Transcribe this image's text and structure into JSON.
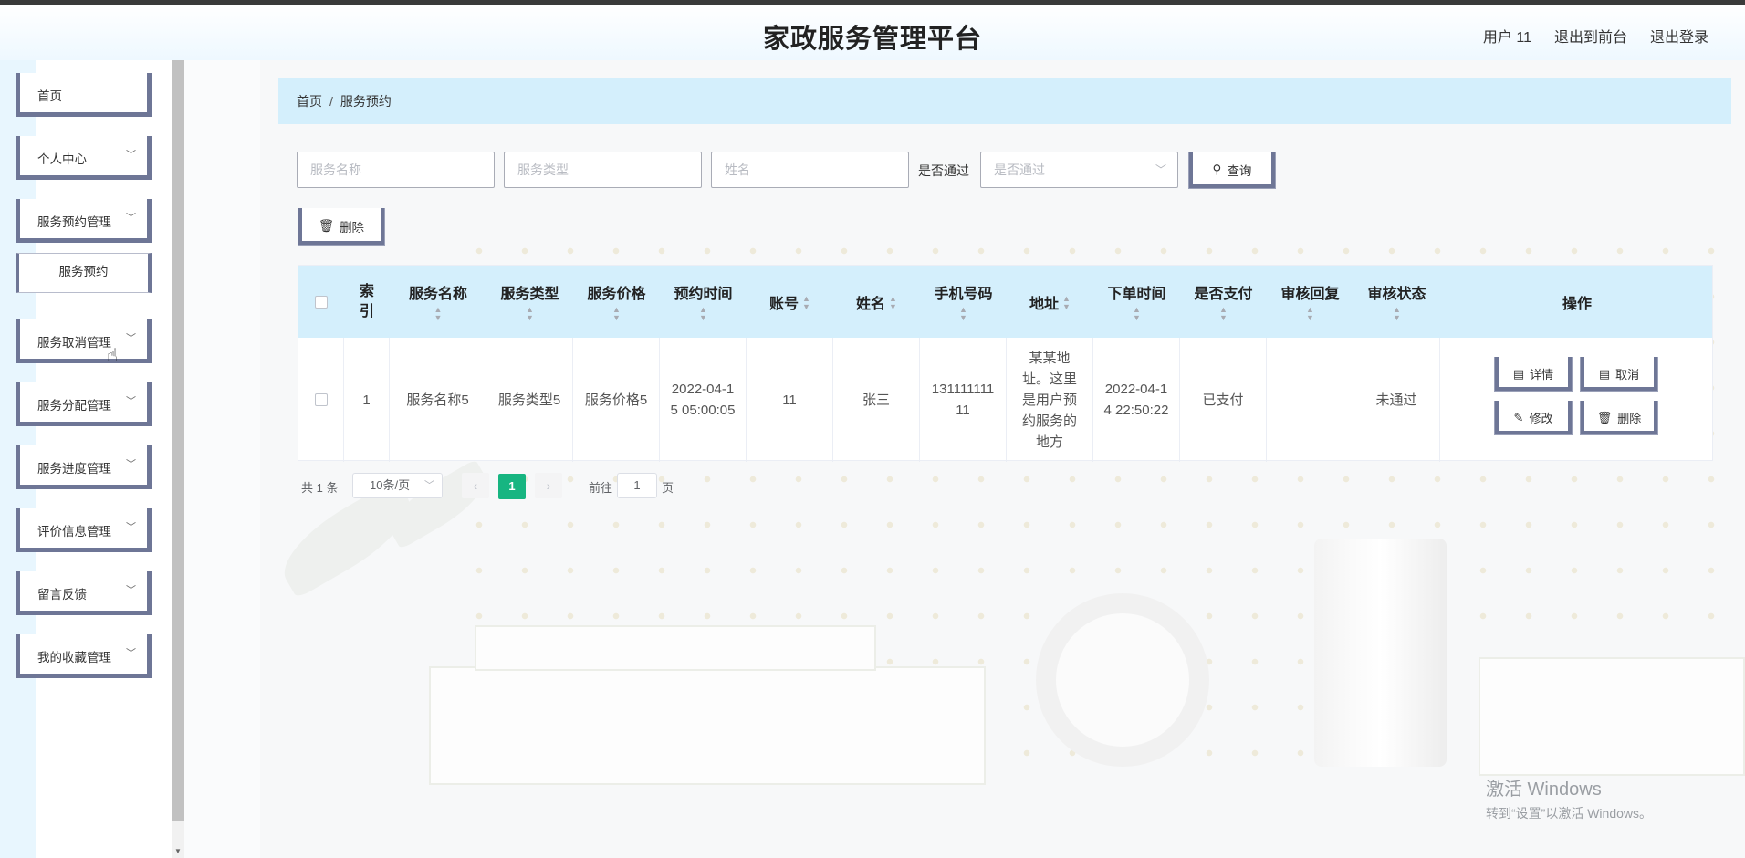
{
  "header": {
    "title": "家政服务管理平台",
    "user": "用户 11",
    "to_front": "退出到前台",
    "logout": "退出登录"
  },
  "sidebar": {
    "items": [
      {
        "label": "首页"
      },
      {
        "label": "个人中心"
      },
      {
        "label": "服务预约管理"
      },
      {
        "label": "服务预约"
      },
      {
        "label": "服务取消管理"
      },
      {
        "label": "服务分配管理"
      },
      {
        "label": "服务进度管理"
      },
      {
        "label": "评价信息管理"
      },
      {
        "label": "留言反馈"
      },
      {
        "label": "我的收藏管理"
      }
    ]
  },
  "breadcrumb": {
    "home": "首页",
    "separator": "/",
    "current": "服务预约"
  },
  "search": {
    "service_name_placeholder": "服务名称",
    "service_type_placeholder": "服务类型",
    "name_placeholder": "姓名",
    "passed_label": "是否通过",
    "passed_placeholder": "是否通过",
    "query_button": "查询"
  },
  "toolbar": {
    "delete_button": "删除"
  },
  "table": {
    "headers": {
      "index": "索引",
      "service_name": "服务名称",
      "service_type": "服务类型",
      "service_price": "服务价格",
      "booking_time": "预约时间",
      "account": "账号",
      "name": "姓名",
      "phone": "手机号码",
      "address": "地址",
      "order_time": "下单时间",
      "paid": "是否支付",
      "review_reply": "审核回复",
      "review_status": "审核状态",
      "actions": "操作"
    },
    "rows": [
      {
        "index": "1",
        "service_name": "服务名称5",
        "service_type": "服务类型5",
        "service_price": "服务价格5",
        "booking_time": "2022-04-15 05:00:05",
        "account": "11",
        "name": "张三",
        "phone": "13111111111",
        "address": "某某地址。这里是用户预约服务的地方",
        "order_time": "2022-04-14 22:50:22",
        "paid": "已支付",
        "review_reply": "",
        "review_status": "未通过"
      }
    ],
    "actions": {
      "detail": "详情",
      "cancel": "取消",
      "edit": "修改",
      "delete": "删除"
    }
  },
  "pagination": {
    "total": "共 1 条",
    "page_size": "10条/页",
    "current_page": "1",
    "goto_label": "前往",
    "goto_value": "1",
    "page_suffix": "页"
  },
  "watermark": {
    "line1": "激活 Windows",
    "line2": "转到“设置”以激活 Windows。"
  }
}
